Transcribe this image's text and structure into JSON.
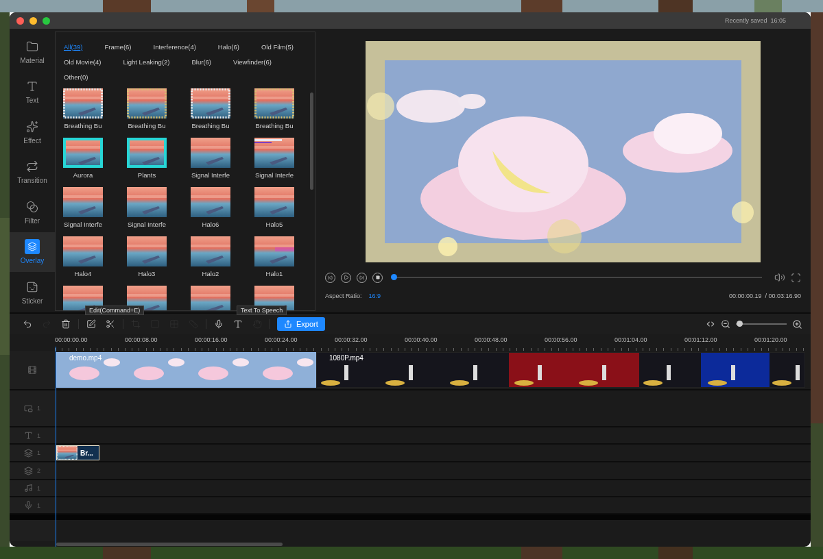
{
  "window": {
    "save_status": "Recently saved",
    "save_time": "16:05"
  },
  "sidebar": [
    {
      "label": "Material",
      "selected": false
    },
    {
      "label": "Text",
      "selected": false
    },
    {
      "label": "Effect",
      "selected": false
    },
    {
      "label": "Transition",
      "selected": false
    },
    {
      "label": "Filter",
      "selected": false
    },
    {
      "label": "Overlay",
      "selected": true
    },
    {
      "label": "Sticker",
      "selected": false
    }
  ],
  "categories": [
    {
      "label": "All(39)",
      "selected": true
    },
    {
      "label": "Frame(6)",
      "selected": false
    },
    {
      "label": "Interference(4)",
      "selected": false
    },
    {
      "label": "Halo(6)",
      "selected": false
    },
    {
      "label": "Old Film(5)",
      "selected": false
    },
    {
      "label": "Old Movie(4)",
      "selected": false
    },
    {
      "label": "Light Leaking(2)",
      "selected": false
    },
    {
      "label": "Blur(6)",
      "selected": false
    },
    {
      "label": "Viewfinder(6)",
      "selected": false
    },
    {
      "label": "Other(0)",
      "selected": false
    }
  ],
  "overlays": [
    {
      "label": "Breathing Bu"
    },
    {
      "label": "Breathing Bu"
    },
    {
      "label": "Breathing Bu"
    },
    {
      "label": "Breathing Bu"
    },
    {
      "label": "Aurora"
    },
    {
      "label": "Plants"
    },
    {
      "label": "Signal Interfe"
    },
    {
      "label": "Signal Interfe"
    },
    {
      "label": "Signal Interfe"
    },
    {
      "label": "Signal Interfe"
    },
    {
      "label": "Halo6"
    },
    {
      "label": "Halo5"
    },
    {
      "label": "Halo4"
    },
    {
      "label": "Halo3"
    },
    {
      "label": "Halo2"
    },
    {
      "label": "Halo1"
    },
    {
      "kind": "picture"
    },
    {
      "kind": "picture"
    },
    {
      "kind": "picture"
    },
    {
      "kind": "picture"
    }
  ],
  "preview": {
    "aspect_label": "Aspect Ratio:",
    "aspect_value": "16:9",
    "current_time": "00:00:00.19",
    "total_time": "/ 00:03:16.90",
    "progress": {
      "level": 0.0
    }
  },
  "toolbar": {
    "tools": [
      {
        "disabled": false
      },
      {
        "disabled": true
      },
      {
        "disabled": false
      },
      {
        "disabled": false
      },
      {
        "disabled": false
      },
      {
        "disabled": true
      },
      {
        "disabled": true
      },
      {
        "disabled": true
      },
      {
        "disabled": true
      },
      {
        "disabled": false
      },
      {
        "disabled": false
      },
      {
        "disabled": true
      }
    ],
    "tooltips": [
      "Edit(Command+E)",
      "Text To Speech"
    ],
    "export": "Export",
    "zoom": {
      "level": 0.07
    }
  },
  "timeline": {
    "ruler": [
      "00:00:00.00",
      "00:00:08.00",
      "00:00:16.00",
      "00:00:24.00",
      "00:00:32.00",
      "00:00:40.00",
      "00:00:48.00",
      "00:00:56.00",
      "00:01:04.00",
      "00:01:12.00",
      "00:01:20.00"
    ],
    "video_clips": [
      {
        "name": "demo.mp4",
        "kind": "clouds",
        "selected": true
      },
      {
        "name": "1080P.mp4",
        "kind": "concert",
        "selected": false
      }
    ],
    "tracks": [
      {
        "kind": "pip",
        "count": "1"
      },
      {
        "kind": "text",
        "count": "1"
      },
      {
        "kind": "overlay",
        "count": "1",
        "clip": "Br..."
      },
      {
        "kind": "overlay",
        "count": "2"
      },
      {
        "kind": "music",
        "count": "1"
      },
      {
        "kind": "voice",
        "count": "1"
      }
    ]
  }
}
